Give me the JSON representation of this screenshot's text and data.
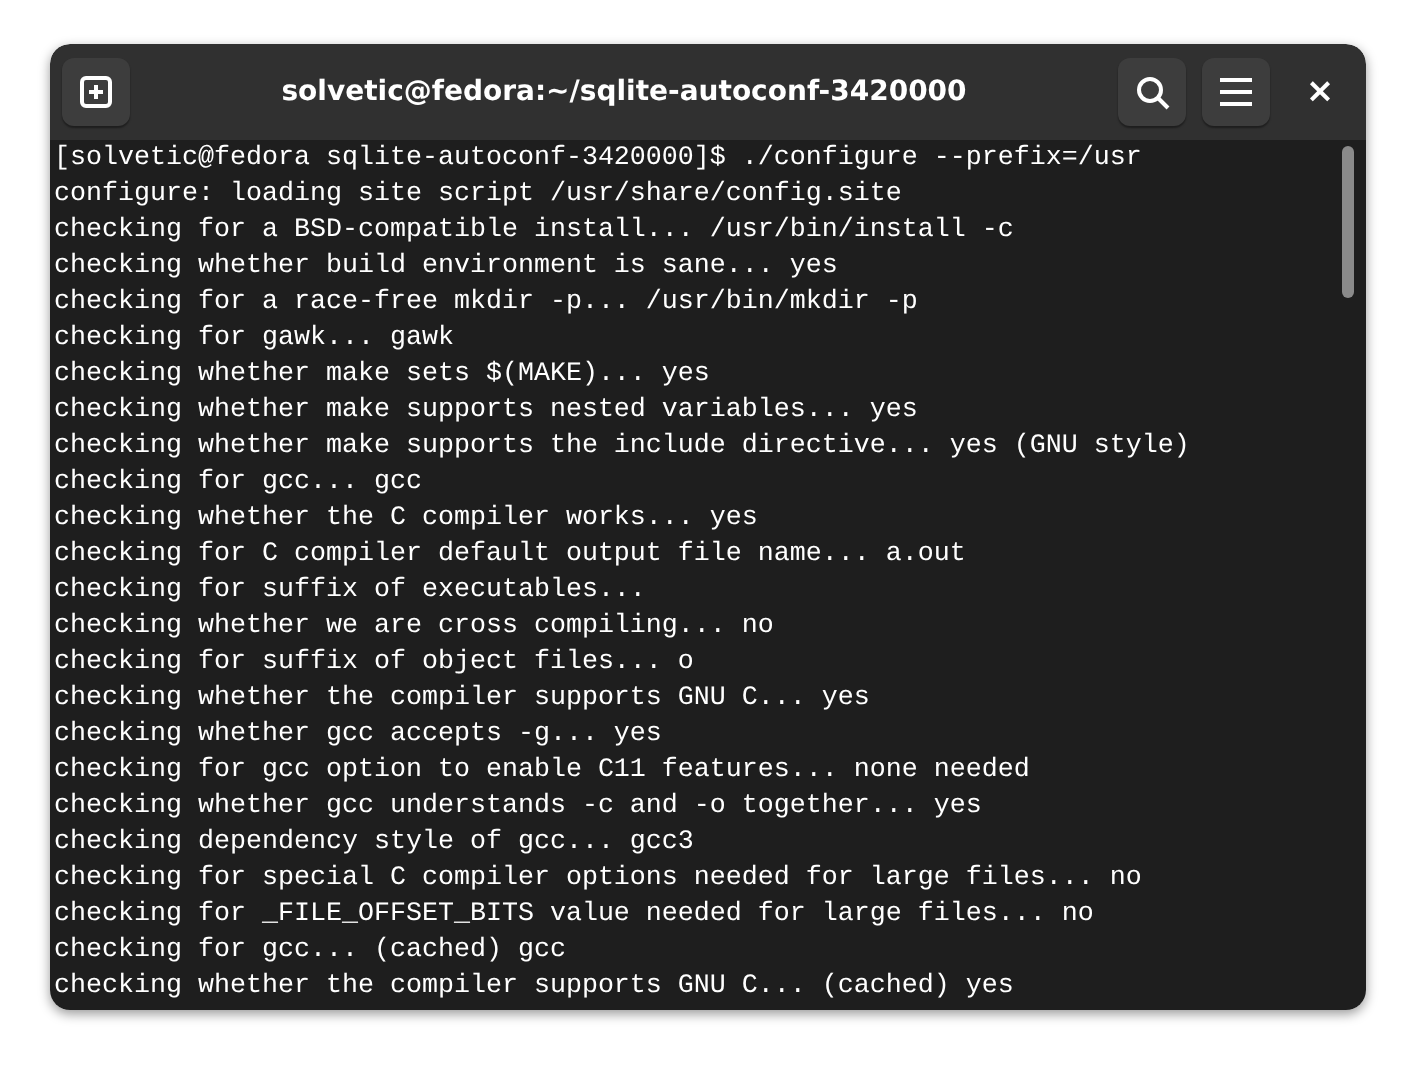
{
  "window": {
    "title": "solvetic@fedora:~/sqlite-autoconf-3420000",
    "close": "×"
  },
  "terminal": {
    "lines": [
      "[solvetic@fedora sqlite-autoconf-3420000]$ ./configure --prefix=/usr",
      "configure: loading site script /usr/share/config.site",
      "checking for a BSD-compatible install... /usr/bin/install -c",
      "checking whether build environment is sane... yes",
      "checking for a race-free mkdir -p... /usr/bin/mkdir -p",
      "checking for gawk... gawk",
      "checking whether make sets $(MAKE)... yes",
      "checking whether make supports nested variables... yes",
      "checking whether make supports the include directive... yes (GNU style)",
      "checking for gcc... gcc",
      "checking whether the C compiler works... yes",
      "checking for C compiler default output file name... a.out",
      "checking for suffix of executables... ",
      "checking whether we are cross compiling... no",
      "checking for suffix of object files... o",
      "checking whether the compiler supports GNU C... yes",
      "checking whether gcc accepts -g... yes",
      "checking for gcc option to enable C11 features... none needed",
      "checking whether gcc understands -c and -o together... yes",
      "checking dependency style of gcc... gcc3",
      "checking for special C compiler options needed for large files... no",
      "checking for _FILE_OFFSET_BITS value needed for large files... no",
      "checking for gcc... (cached) gcc",
      "checking whether the compiler supports GNU C... (cached) yes"
    ]
  }
}
